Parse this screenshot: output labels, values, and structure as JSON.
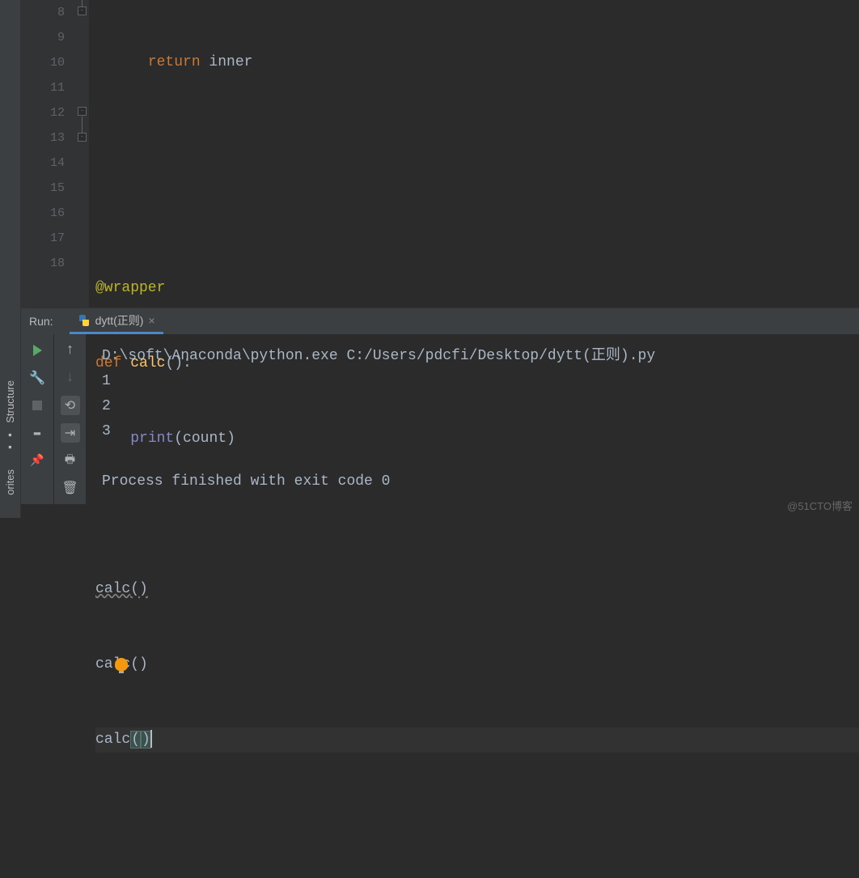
{
  "gutter": {
    "lines": [
      8,
      9,
      10,
      11,
      12,
      13,
      14,
      15,
      16,
      17,
      18
    ]
  },
  "code": {
    "l8": {
      "kw": "return",
      "id": " inner"
    },
    "l11": {
      "dec": "@wrapper"
    },
    "l12": {
      "kw1": "def ",
      "fn": "calc",
      "rest": "():"
    },
    "l13": {
      "bi": "print",
      "p1": "(",
      "arg": "count",
      "p2": ")"
    },
    "l15": {
      "fn": "calc",
      "p": "()"
    },
    "l16": {
      "fn": "calc",
      "p": "()"
    },
    "l17": {
      "fn": "calc",
      "p1": "(",
      "p2": ")"
    }
  },
  "sidebar": {
    "structure": "Structure",
    "favorites": "orites"
  },
  "run": {
    "label": "Run:",
    "tab_name": "dytt(正则)",
    "output": {
      "cmd_head": "D:\\soft\\Anaconda\\python.exe C:/Users/pdcfi/Desktop/dytt",
      "cmd_paren1": "(",
      "cmd_cjk": "正则",
      "cmd_paren2": ")",
      "cmd_tail": ".py",
      "line1": "1",
      "line2": "2",
      "line3": "3",
      "exit": "Process finished with exit code 0"
    }
  },
  "watermark": "@51CTO博客"
}
